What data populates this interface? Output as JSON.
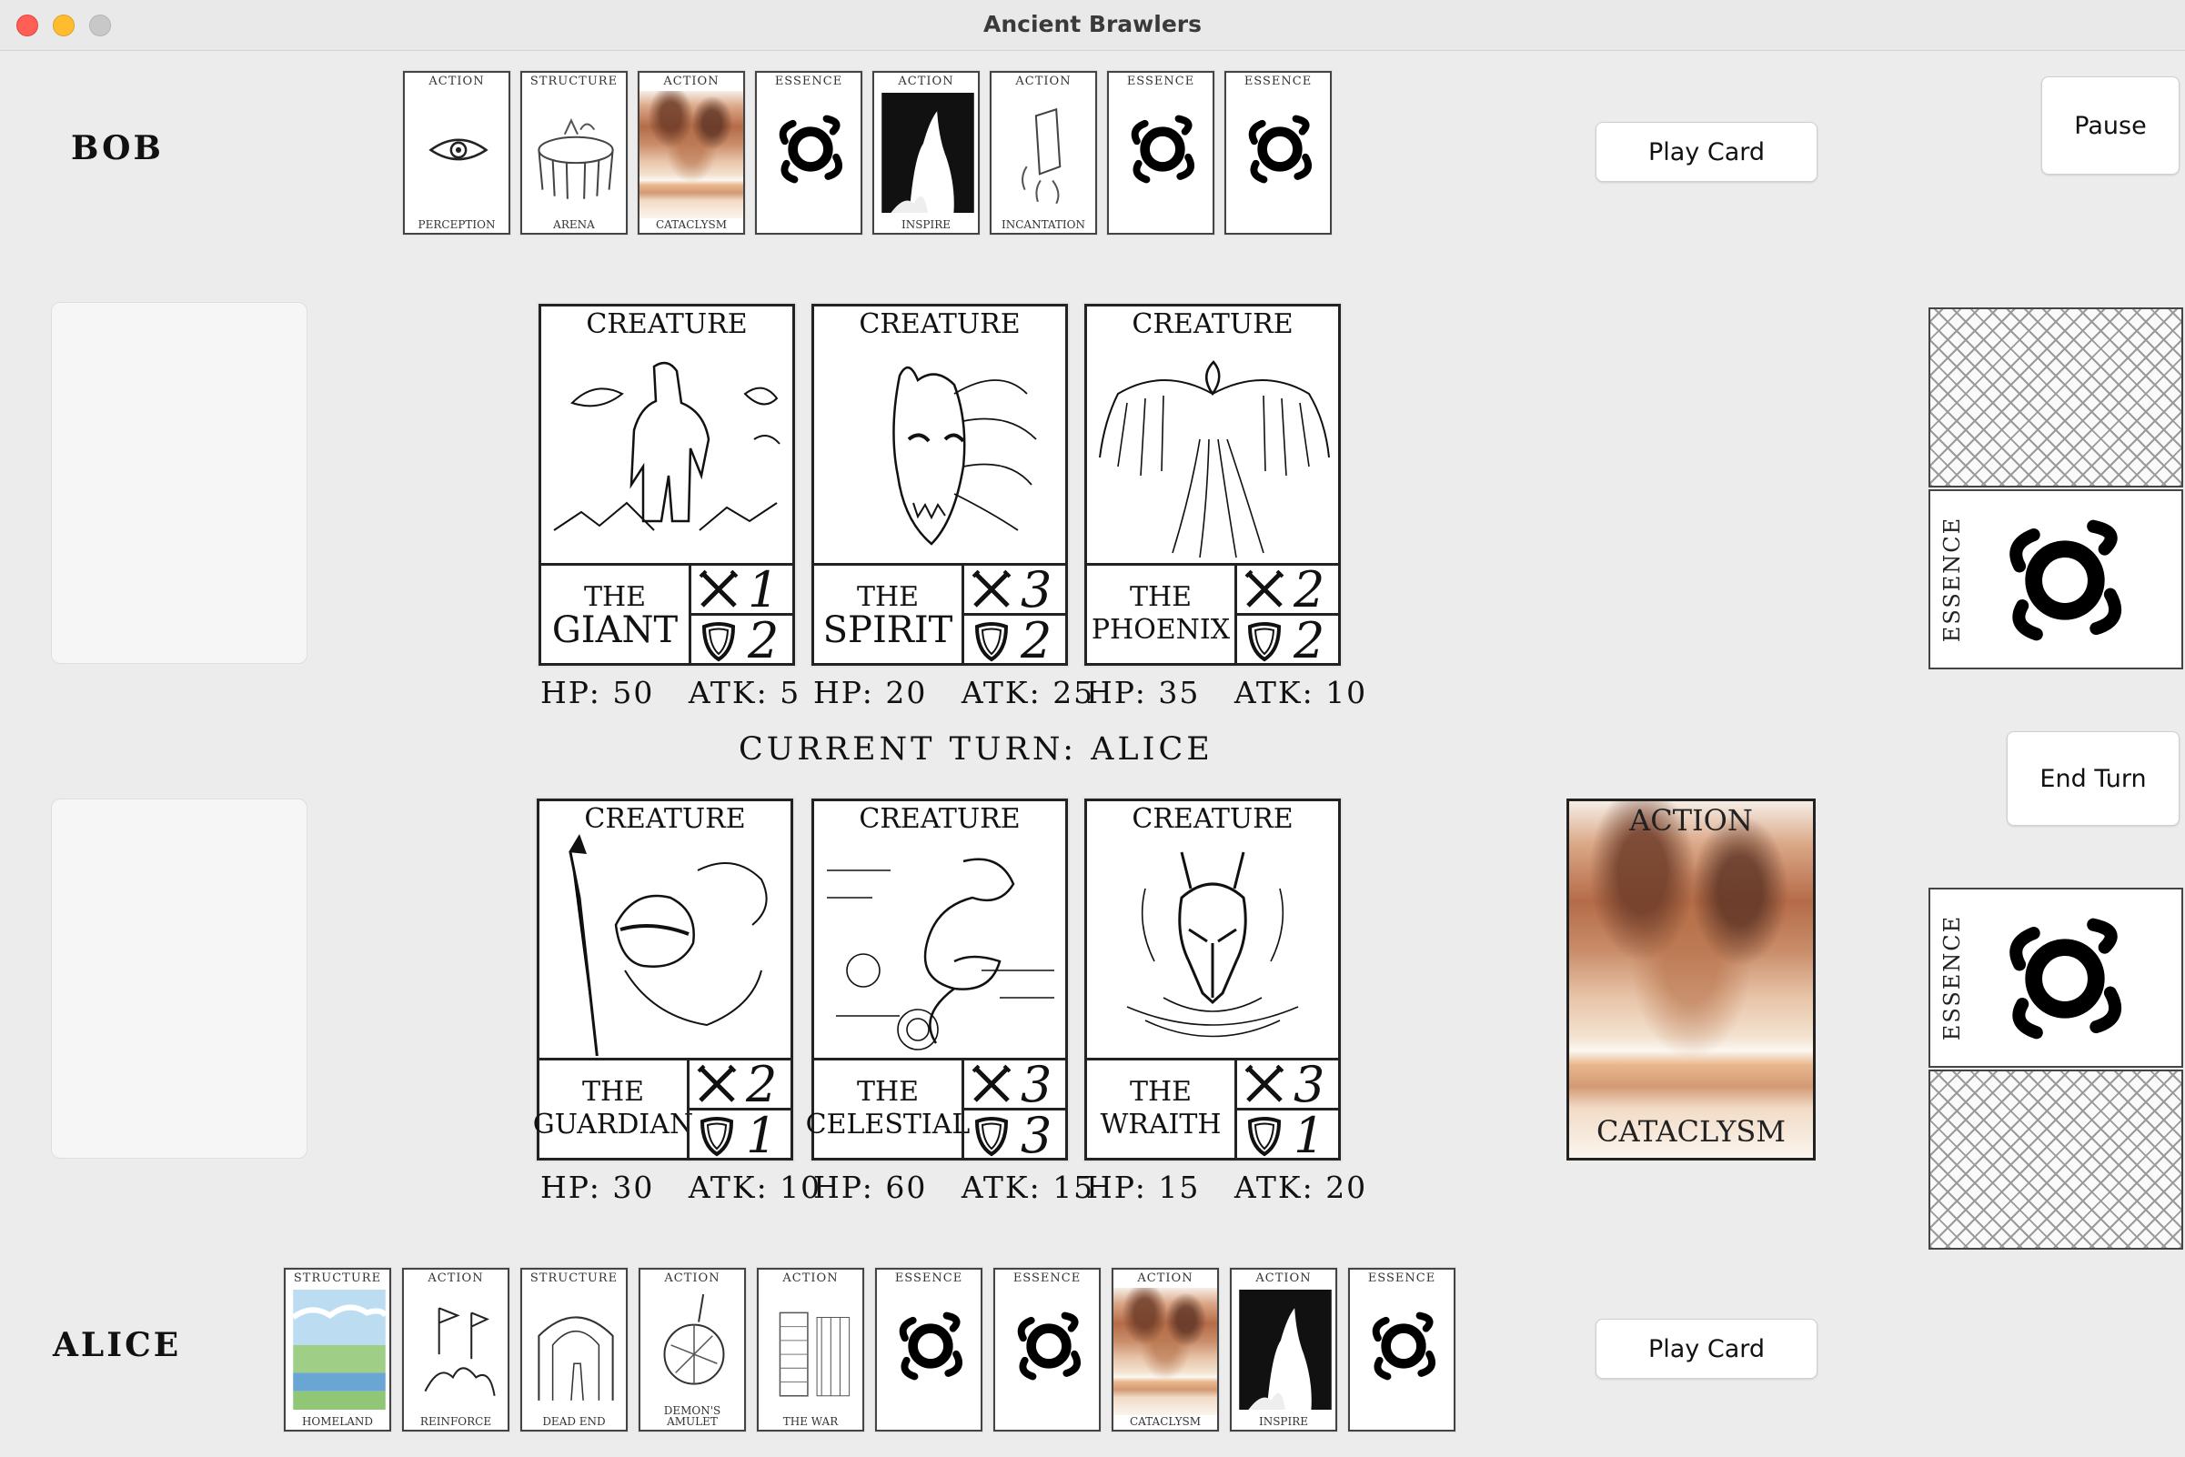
{
  "window": {
    "title": "Ancient Brawlers"
  },
  "players": {
    "opponent": {
      "name": "BOB",
      "play_label": "Play Card"
    },
    "self": {
      "name": "ALICE",
      "play_label": "Play Card"
    }
  },
  "controls": {
    "pause_label": "Pause",
    "end_turn_label": "End Turn"
  },
  "turn": {
    "text": "CURRENT TURN: ALICE"
  },
  "bob_hand": [
    {
      "type": "ACTION",
      "name": "PERCEPTION",
      "icon": "eye-icon"
    },
    {
      "type": "STRUCTURE",
      "name": "ARENA",
      "icon": "arena-icon"
    },
    {
      "type": "ACTION",
      "name": "CATACLYSM",
      "icon": "cataclysm-icon"
    },
    {
      "type": "ESSENCE",
      "name": "",
      "icon": "essence-icon"
    },
    {
      "type": "ACTION",
      "name": "INSPIRE",
      "icon": "inspire-icon"
    },
    {
      "type": "ACTION",
      "name": "INCANTATION",
      "icon": "incantation-icon"
    },
    {
      "type": "ESSENCE",
      "name": "",
      "icon": "essence-icon"
    },
    {
      "type": "ESSENCE",
      "name": "",
      "icon": "essence-icon"
    }
  ],
  "alice_hand": [
    {
      "type": "STRUCTURE",
      "name": "HOMELAND",
      "icon": "homeland-icon"
    },
    {
      "type": "ACTION",
      "name": "REINFORCE",
      "icon": "reinforce-icon"
    },
    {
      "type": "STRUCTURE",
      "name": "DEAD END",
      "icon": "dead-end-icon"
    },
    {
      "type": "ACTION",
      "name": "DEMON'S AMULET",
      "icon": "amulet-icon"
    },
    {
      "type": "ACTION",
      "name": "THE WAR",
      "icon": "war-icon"
    },
    {
      "type": "ESSENCE",
      "name": "",
      "icon": "essence-icon"
    },
    {
      "type": "ESSENCE",
      "name": "",
      "icon": "essence-icon"
    },
    {
      "type": "ACTION",
      "name": "CATACLYSM",
      "icon": "cataclysm-icon"
    },
    {
      "type": "ACTION",
      "name": "INSPIRE",
      "icon": "inspire-icon"
    },
    {
      "type": "ESSENCE",
      "name": "",
      "icon": "essence-icon"
    }
  ],
  "bob_creatures": [
    {
      "type": "CREATURE",
      "the": "THE",
      "name": "GIANT",
      "atk_stat": "1",
      "def_stat": "2",
      "hp_text": "HP: 50",
      "atk_text": "ATK: 5"
    },
    {
      "type": "CREATURE",
      "the": "THE",
      "name": "SPIRIT",
      "atk_stat": "3",
      "def_stat": "2",
      "hp_text": "HP: 20",
      "atk_text": "ATK: 25"
    },
    {
      "type": "CREATURE",
      "the": "THE",
      "name": "PHOENIX",
      "atk_stat": "2",
      "def_stat": "2",
      "hp_text": "HP: 35",
      "atk_text": "ATK: 10"
    }
  ],
  "alice_creatures": [
    {
      "type": "CREATURE",
      "the": "THE",
      "name": "GUARDIAN",
      "atk_stat": "2",
      "def_stat": "1",
      "hp_text": "HP: 30",
      "atk_text": "ATK: 10"
    },
    {
      "type": "CREATURE",
      "the": "THE",
      "name": "CELESTIAL",
      "atk_stat": "3",
      "def_stat": "3",
      "hp_text": "HP: 60",
      "atk_text": "ATK: 15"
    },
    {
      "type": "CREATURE",
      "the": "THE",
      "name": "WRAITH",
      "atk_stat": "3",
      "def_stat": "1",
      "hp_text": "HP: 15",
      "atk_text": "ATK: 20"
    }
  ],
  "piles": {
    "bob_essence": {
      "type": "ESSENCE"
    },
    "alice_essence": {
      "type": "ESSENCE"
    },
    "played_action": {
      "type": "ACTION",
      "name": "CATACLYSM"
    }
  },
  "colors": {
    "background": "#ececec",
    "card_border": "#222222",
    "button_bg": "#ffffff"
  }
}
